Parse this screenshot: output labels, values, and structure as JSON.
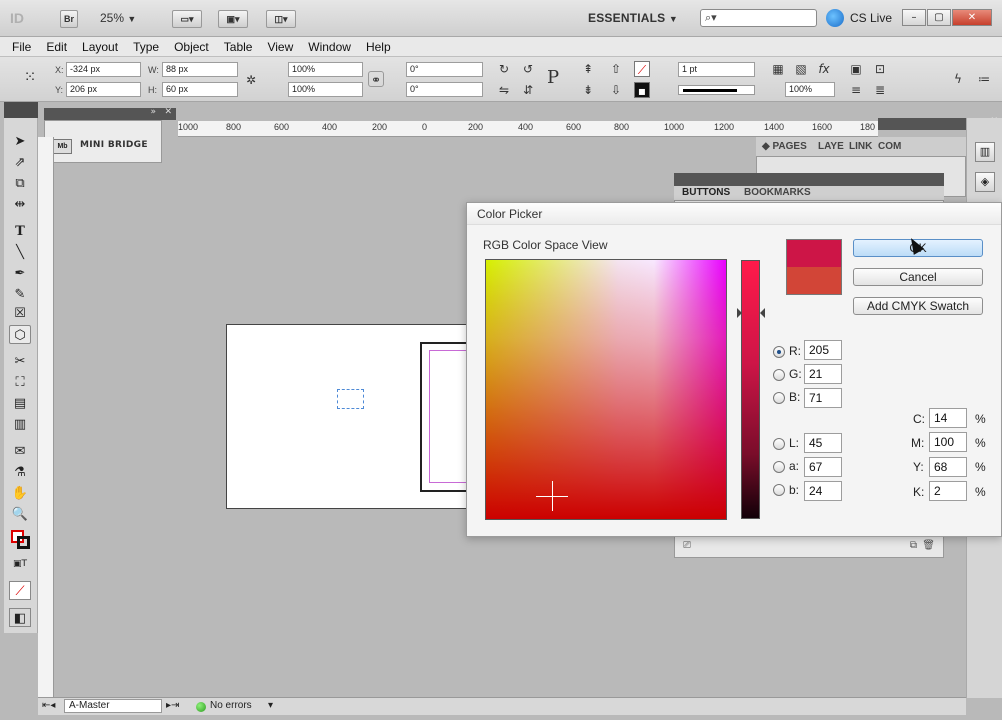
{
  "app": {
    "logo": "ID",
    "bridge_btn": "Br",
    "zoom": "25%",
    "workspace": "ESSENTIALS",
    "cslive": "CS Live"
  },
  "menu": [
    "File",
    "Edit",
    "Layout",
    "Type",
    "Object",
    "Table",
    "View",
    "Window",
    "Help"
  ],
  "control": {
    "x_label": "X:",
    "x_value": "-324 px",
    "y_label": "Y:",
    "y_value": "206 px",
    "w_label": "W:",
    "w_value": "88 px",
    "h_label": "H:",
    "h_value": "60 px",
    "scale_x": "100%",
    "scale_y": "100%",
    "rotate": "0°",
    "shear": "0°",
    "stroke_weight": "1 pt",
    "opacity": "100%"
  },
  "mini_bridge": {
    "icon": "Mb",
    "label": "MINI BRIDGE"
  },
  "ruler": {
    "ticks": [
      "1000",
      "800",
      "600",
      "400",
      "200",
      "0",
      "200",
      "400",
      "600",
      "800",
      "1000",
      "1200",
      "1400",
      "1600",
      "180"
    ]
  },
  "panels": {
    "pages_tabs": [
      "PAGES",
      "LAYE",
      "LINK",
      "COM"
    ],
    "buttons_tabs": [
      "BUTTONS",
      "BOOKMARKS"
    ]
  },
  "status": {
    "master": "A-Master",
    "errors": "No errors"
  },
  "dialog": {
    "title": "Color Picker",
    "space_label": "RGB Color Space View",
    "ok": "OK",
    "cancel": "Cancel",
    "add_swatch": "Add CMYK Swatch",
    "rgb": [
      {
        "label": "R:",
        "value": "205",
        "selected": true
      },
      {
        "label": "G:",
        "value": "21",
        "selected": false
      },
      {
        "label": "B:",
        "value": "71",
        "selected": false
      }
    ],
    "lab": [
      {
        "label": "L:",
        "value": "45"
      },
      {
        "label": "a:",
        "value": "67"
      },
      {
        "label": "b:",
        "value": "24"
      }
    ],
    "cmyk": [
      {
        "label": "C:",
        "value": "14",
        "unit": "%"
      },
      {
        "label": "M:",
        "value": "100",
        "unit": "%"
      },
      {
        "label": "Y:",
        "value": "68",
        "unit": "%"
      },
      {
        "label": "K:",
        "value": "2",
        "unit": "%"
      }
    ],
    "colors": {
      "new": "#cd1547",
      "previous": "#d24537"
    }
  }
}
